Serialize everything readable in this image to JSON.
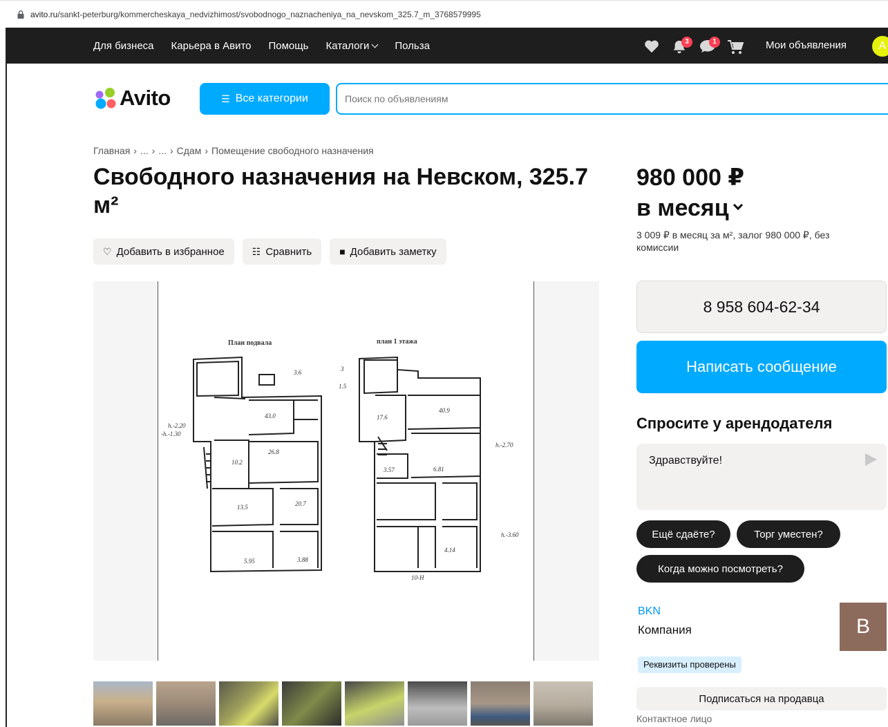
{
  "browser": {
    "url_host": "avito.ru",
    "url_path": "/sankt-peterburg/kommercheskaya_nedvizhimost/svobodnogo_naznacheniya_na_nevskom_325.7_m_3768579995"
  },
  "topnav": {
    "links": [
      "Для бизнеса",
      "Карьера в Авито",
      "Помощь",
      "Каталоги",
      "Польза"
    ],
    "notifications_count": "3",
    "messages_count": "1",
    "my_ads": "Мои объявления",
    "avatar_letter": "А"
  },
  "header": {
    "logo_text": "Avito",
    "categories_button": "Все категории",
    "search_placeholder": "Поиск по объявлениям",
    "accent_color": "#00aaff"
  },
  "breadcrumb": [
    "Главная",
    "...",
    "...",
    "Сдам",
    "Помещение свободного назначения"
  ],
  "listing": {
    "title": "Свободного назначения на Невском, 325.7 м²",
    "actions": {
      "favorite": "Добавить в избранное",
      "compare": "Сравнить",
      "note": "Добавить заметку"
    },
    "plan_labels": {
      "basement": "План подвала",
      "floor1": "план 1 этажа"
    },
    "thumbnail_count": 8
  },
  "pricing": {
    "price": "980 000 ₽",
    "period": "в месяц",
    "note": "3 009 ₽ в месяц за м², залог 980 000 ₽, без комиссии"
  },
  "contact": {
    "phone": "8 958 604-62-34",
    "write_button": "Написать сообщение",
    "ask_heading": "Спросите у арендодателя",
    "ask_text": "Здравствуйте!",
    "quick_questions": [
      "Ещё сдаёте?",
      "Торг уместен?",
      "Когда можно посмотреть?"
    ]
  },
  "seller": {
    "name": "BKN",
    "type": "Компания",
    "avatar_letter": "B",
    "verified_badge": "Реквизиты проверены",
    "subscribe_button": "Подписаться на продавца",
    "contact_person": "Контактное лицо"
  }
}
